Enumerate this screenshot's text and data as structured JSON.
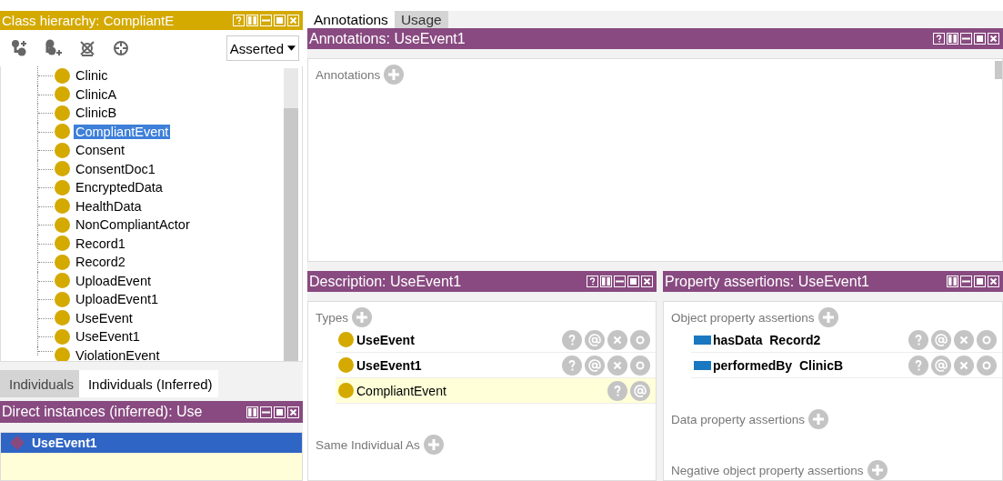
{
  "class_hierarchy": {
    "title": "Class hierarchy: CompliantE",
    "view_dropdown": {
      "value": "Asserted"
    },
    "tree": [
      {
        "label": "Clinic",
        "selected": false
      },
      {
        "label": "ClinicA",
        "selected": false
      },
      {
        "label": "ClinicB",
        "selected": false
      },
      {
        "label": "CompliantEvent",
        "selected": true
      },
      {
        "label": "Consent",
        "selected": false
      },
      {
        "label": "ConsentDoc1",
        "selected": false
      },
      {
        "label": "EncryptedData",
        "selected": false
      },
      {
        "label": "HealthData",
        "selected": false
      },
      {
        "label": "NonCompliantActor",
        "selected": false
      },
      {
        "label": "Record1",
        "selected": false
      },
      {
        "label": "Record2",
        "selected": false
      },
      {
        "label": "UploadEvent",
        "selected": false
      },
      {
        "label": "UploadEvent1",
        "selected": false
      },
      {
        "label": "UseEvent",
        "selected": false
      },
      {
        "label": "UseEvent1",
        "selected": false
      },
      {
        "label": "ViolationEvent",
        "selected": false
      }
    ]
  },
  "individuals_tabs": [
    {
      "label": "Individuals",
      "selected": false
    },
    {
      "label": "Individuals (Inferred)",
      "selected": true
    }
  ],
  "direct_instances": {
    "title": "Direct instances (inferred): Use",
    "items": [
      {
        "label": "UseEvent1",
        "selected": true
      }
    ]
  },
  "editor_tabs": [
    {
      "label": "Annotations",
      "selected": true
    },
    {
      "label": "Usage",
      "selected": false
    }
  ],
  "annotations": {
    "title": "Annotations: UseEvent1",
    "section": "Annotations"
  },
  "description": {
    "title": "Description: UseEvent1",
    "types_label": "Types",
    "types": [
      {
        "label": "UseEvent",
        "inferred": false
      },
      {
        "label": "UseEvent1",
        "inferred": false
      },
      {
        "label": "CompliantEvent",
        "inferred": true
      }
    ],
    "same_individual_label": "Same Individual As"
  },
  "property_assertions": {
    "title": "Property assertions: UseEvent1",
    "object_label": "Object property assertions",
    "object_assertions": [
      {
        "property": "hasData",
        "value": "Record2"
      },
      {
        "property": "performedBy",
        "value": "ClinicB"
      }
    ],
    "data_label": "Data property assertions",
    "negative_label": "Negative object property assertions"
  }
}
